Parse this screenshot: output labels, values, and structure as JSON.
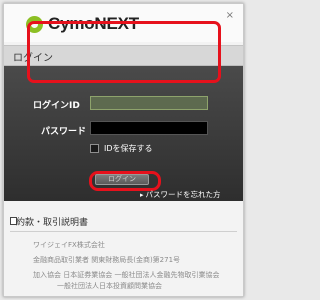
{
  "header": {
    "brand": "CymoNEXT",
    "close_icon_glyph": "×"
  },
  "title_bar": {
    "title": "ログイン"
  },
  "form": {
    "login_id_label": "ログインID",
    "login_id_value": "",
    "password_label": "パスワード",
    "password_value": "",
    "save_id_label": "IDを保存する",
    "save_id_checked": false,
    "login_button": "ログイン",
    "forgot_password": "パスワードを忘れた方"
  },
  "terms": {
    "label": "約款・取引説明書"
  },
  "footer": {
    "company": "ワイジェイFX株式会社",
    "registration": "金融商品取引業者 関東財務局長(金商)第271号",
    "associations_1": "加入協会 日本証券業協会 一般社団法人金融先物取引業協会",
    "associations_2": "一般社団法人日本投資顧問業協会"
  },
  "colors": {
    "brand_green": "#8cbf24",
    "highlight_red": "#e6111c",
    "panel_dark": "#3a3a3a"
  }
}
